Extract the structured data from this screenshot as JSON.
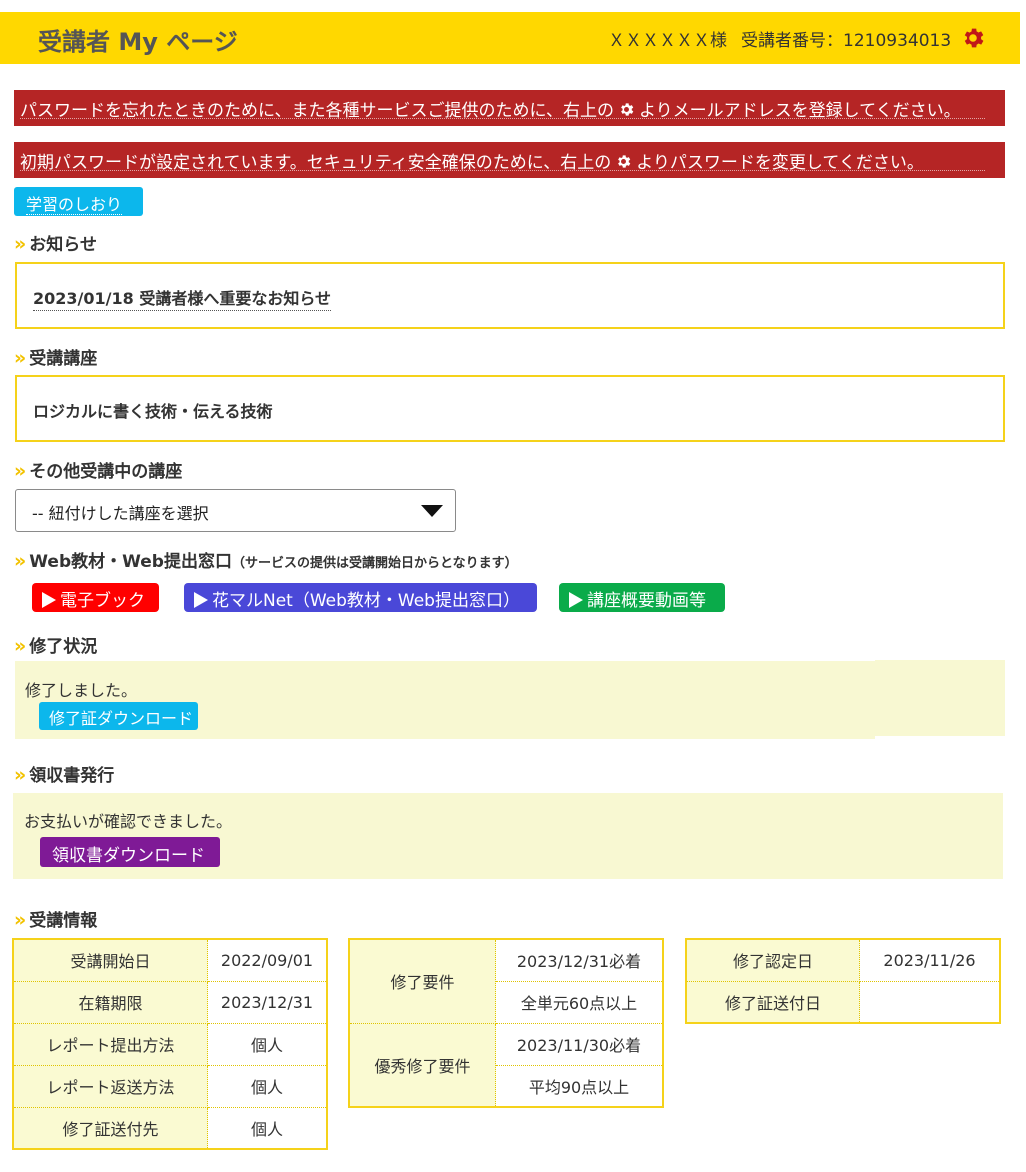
{
  "header": {
    "title": "受講者 My ページ",
    "user_name": "ＸＸＸＸＸＸ様",
    "student_no_label": "受講者番号：1210934013",
    "settings_icon": "gear-icon"
  },
  "alerts": [
    {
      "before": "パスワードを忘れたときのために、また各種サービスご提供のために、右上の",
      "after": "よりメールアドレスを登録してください。"
    },
    {
      "before": "初期パスワードが設定されています。セキュリティ安全確保のために、右上の",
      "after": "よりパスワードを変更してください。"
    }
  ],
  "study_guide_button": "学習のしおり",
  "sections": {
    "news": "お知らせ",
    "course": "受講講座",
    "other_courses": "その他受講中の講座",
    "web": "Web教材・Web提出窓口",
    "web_note": "（サービスの提供は受講開始日からとなります）",
    "completion": "修了状況",
    "receipt": "領収書発行",
    "info": "受講情報"
  },
  "news_item": "2023/01/18 受講者様へ重要なお知らせ",
  "course_name": "ロジカルに書く技術・伝える技術",
  "course_select": {
    "selected": "-- 紐付けした講座を選択"
  },
  "web_buttons": {
    "ebook": "電子ブック",
    "hanamaru": "花マルNet（Web教材・Web提出窓口）",
    "video": "講座概要動画等",
    "colors": {
      "ebook": "#ff0000",
      "hanamaru": "#4a48d8",
      "video": "#0aab4a"
    }
  },
  "completion": {
    "message": "修了しました。",
    "button": "修了証ダウンロード"
  },
  "receipt": {
    "message": "お支払いが確認できました。",
    "button": "領収書ダウンロード"
  },
  "info": {
    "t1": [
      {
        "label": "受講開始日",
        "value": "2022/09/01"
      },
      {
        "label": "在籍期限",
        "value": "2023/12/31"
      },
      {
        "label": "レポート提出方法",
        "value": "個人"
      },
      {
        "label": "レポート返送方法",
        "value": "個人"
      },
      {
        "label": "修了証送付先",
        "value": "個人"
      }
    ],
    "t2": [
      {
        "label": "修了要件",
        "values": [
          "2023/12/31必着",
          "全単元60点以上"
        ]
      },
      {
        "label": "優秀修了要件",
        "values": [
          "2023/11/30必着",
          "平均90点以上"
        ]
      }
    ],
    "t3": [
      {
        "label": "修了認定日",
        "value": "2023/11/26"
      },
      {
        "label": "修了証送付日",
        "value": ""
      }
    ]
  },
  "colors": {
    "header_bg": "#ffd800",
    "alert_bg": "#b52525",
    "accent": "#f5d21a",
    "settings_icon": "#c01818"
  }
}
